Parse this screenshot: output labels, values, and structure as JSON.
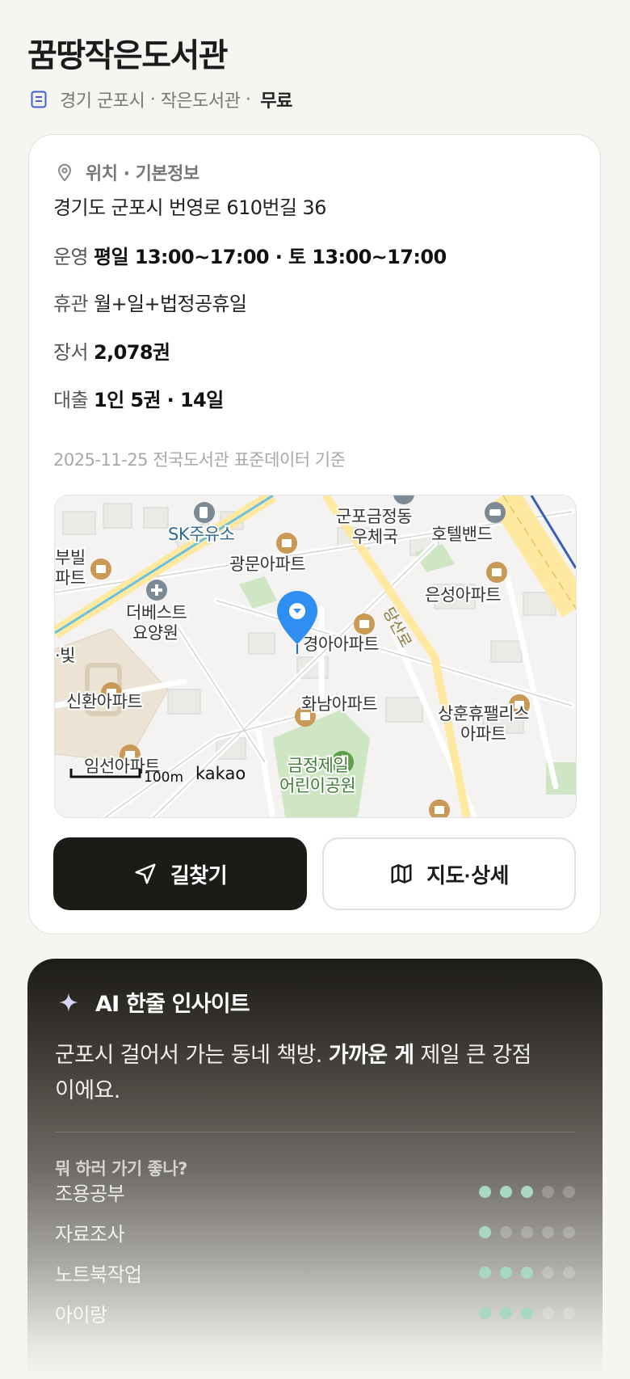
{
  "library": {
    "name": "꿈땅작은도서관",
    "region": "경기 군포시",
    "type": "작은도서관",
    "fee": "무료"
  },
  "info_section": {
    "heading": "위치 · 기본정보",
    "address": "경기도 군포시 번영로 610번길 36",
    "hours_label": "운영",
    "hours_value": "평일 13:00~17:00 · 토 13:00~17:00",
    "closed_label": "휴관",
    "closed_value": "월+일+법정공휴일",
    "books_label": "장서",
    "books_value": "2,078권",
    "loan_label": "대출",
    "loan_value": "1인 5권 · 14일",
    "data_note": "2025-11-25 전국도서관 표준데이터 기준"
  },
  "map": {
    "labels": {
      "sk": "SK주유소",
      "post1": "군포금정동",
      "post2": "우체국",
      "hotel": "호텔밴드",
      "bubil1": "부빌",
      "bubil2": "파트",
      "gwangmun": "광문아파트",
      "eunsung": "은성아파트",
      "best1": "더베스트",
      "best2": "요양원",
      "road": "당산로",
      "bit": "·빛",
      "gyeonga": "경아아파트",
      "shinhwan": "신환아파트",
      "hwanam": "화남아파트",
      "sanghun1": "상훈휴팰리스",
      "sanghun2": "아파트",
      "imseon": "임선아파트",
      "park1": "금정제일",
      "park2": "어린이공원"
    },
    "scale": "100m",
    "brand": "kakao"
  },
  "buttons": {
    "directions": "길찾기",
    "map_detail": "지도·상세"
  },
  "ai": {
    "title": "AI 한줄 인사이트",
    "text_pre": "군포시 걸어서 가는 동네 책방. ",
    "text_bold": "가까운 게",
    "text_post": " 제일 큰 강점이에요.",
    "question": "뭐 하러 가기 좋나?",
    "activities": [
      {
        "label": "조용공부",
        "score": 3,
        "max": 5
      },
      {
        "label": "자료조사",
        "score": 1,
        "max": 5
      },
      {
        "label": "노트북작업",
        "score": 3,
        "max": 5
      },
      {
        "label": "아이랑",
        "score": 3,
        "max": 5
      }
    ]
  }
}
